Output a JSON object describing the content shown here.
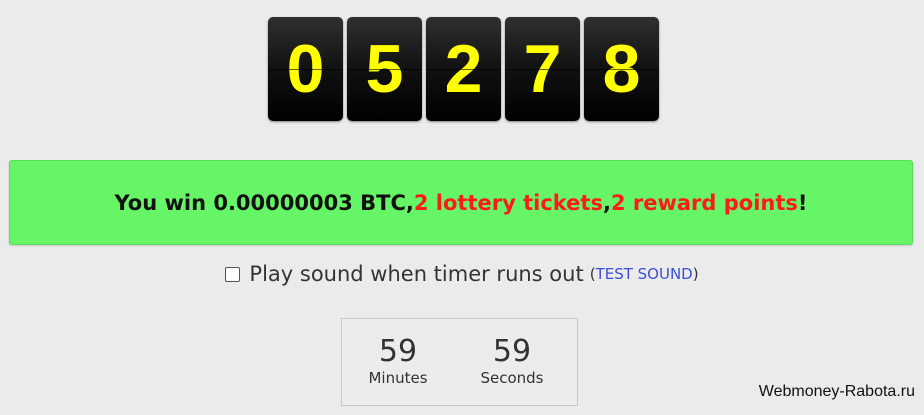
{
  "lottery_digits": [
    "0",
    "5",
    "2",
    "7",
    "8"
  ],
  "win_message": {
    "prefix": "You win 0.00000003 BTC, ",
    "tickets": "2 lottery tickets",
    "separator": ", ",
    "points": "2 reward points",
    "suffix": "!"
  },
  "sound_option": {
    "checked": false,
    "label": "Play sound when timer runs out",
    "test_open": "(",
    "test_link": "TEST SOUND",
    "test_close": ")"
  },
  "countdown": {
    "minutes_value": "59",
    "minutes_label": "Minutes",
    "seconds_value": "59",
    "seconds_label": "Seconds"
  },
  "watermark": "Webmoney-Rabota.ru",
  "colors": {
    "digit_text": "#ffff00",
    "banner_bg": "#66f566",
    "highlight_red": "#ff1a1a",
    "link_blue": "#3b4fd6"
  }
}
